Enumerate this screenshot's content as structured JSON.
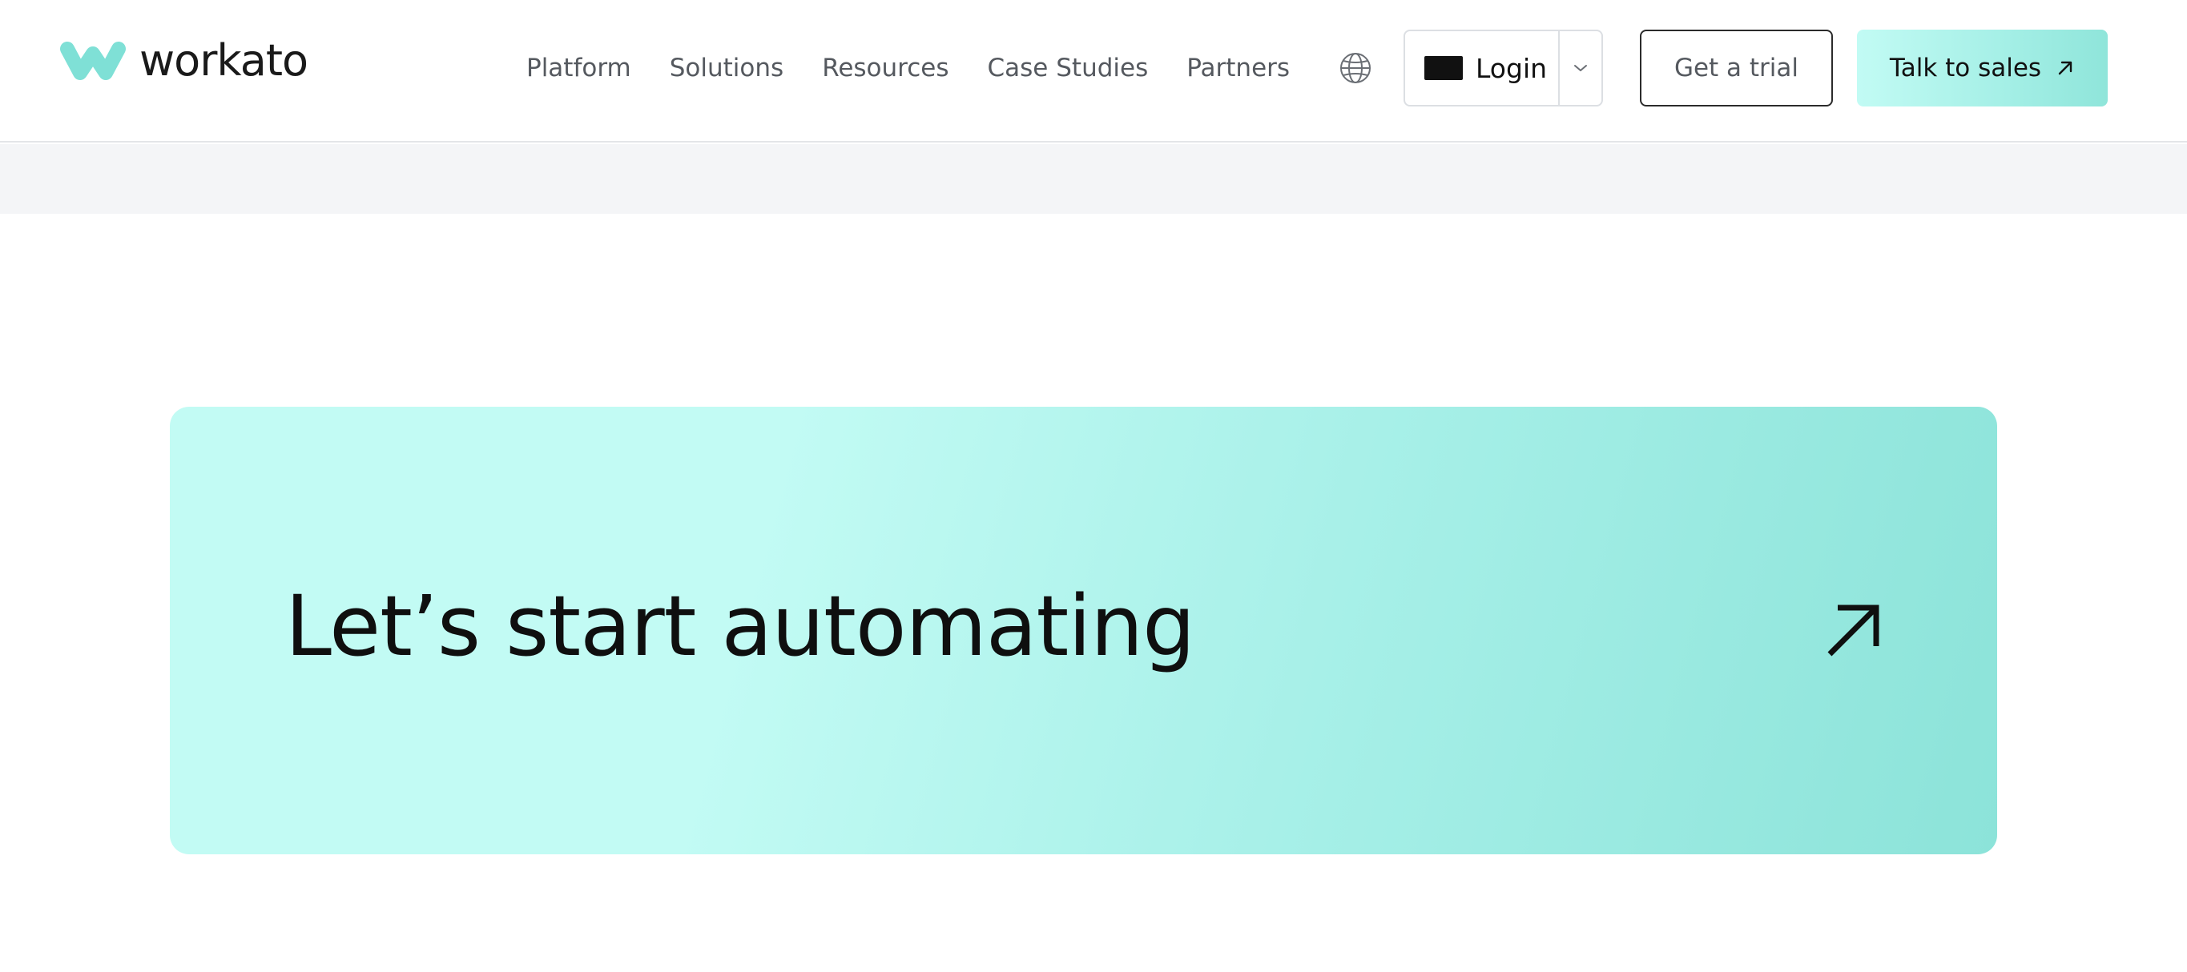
{
  "brand": {
    "name": "workato",
    "accent_color": "#7fe0d6"
  },
  "nav": {
    "items": [
      {
        "label": "Platform"
      },
      {
        "label": "Solutions"
      },
      {
        "label": "Resources"
      },
      {
        "label": "Case Studies"
      },
      {
        "label": "Partners"
      }
    ]
  },
  "header_actions": {
    "language_icon": "globe-icon",
    "login_label": "Login",
    "login_dropdown_icon": "chevron-down-icon",
    "trial_label": "Get a trial",
    "sales_label": "Talk to sales",
    "sales_icon": "arrow-up-right-icon"
  },
  "cta": {
    "title": "Let’s start automating",
    "icon": "arrow-up-right-icon",
    "gradient_start": "#c2fbf4",
    "gradient_end": "#8ce3d9"
  }
}
